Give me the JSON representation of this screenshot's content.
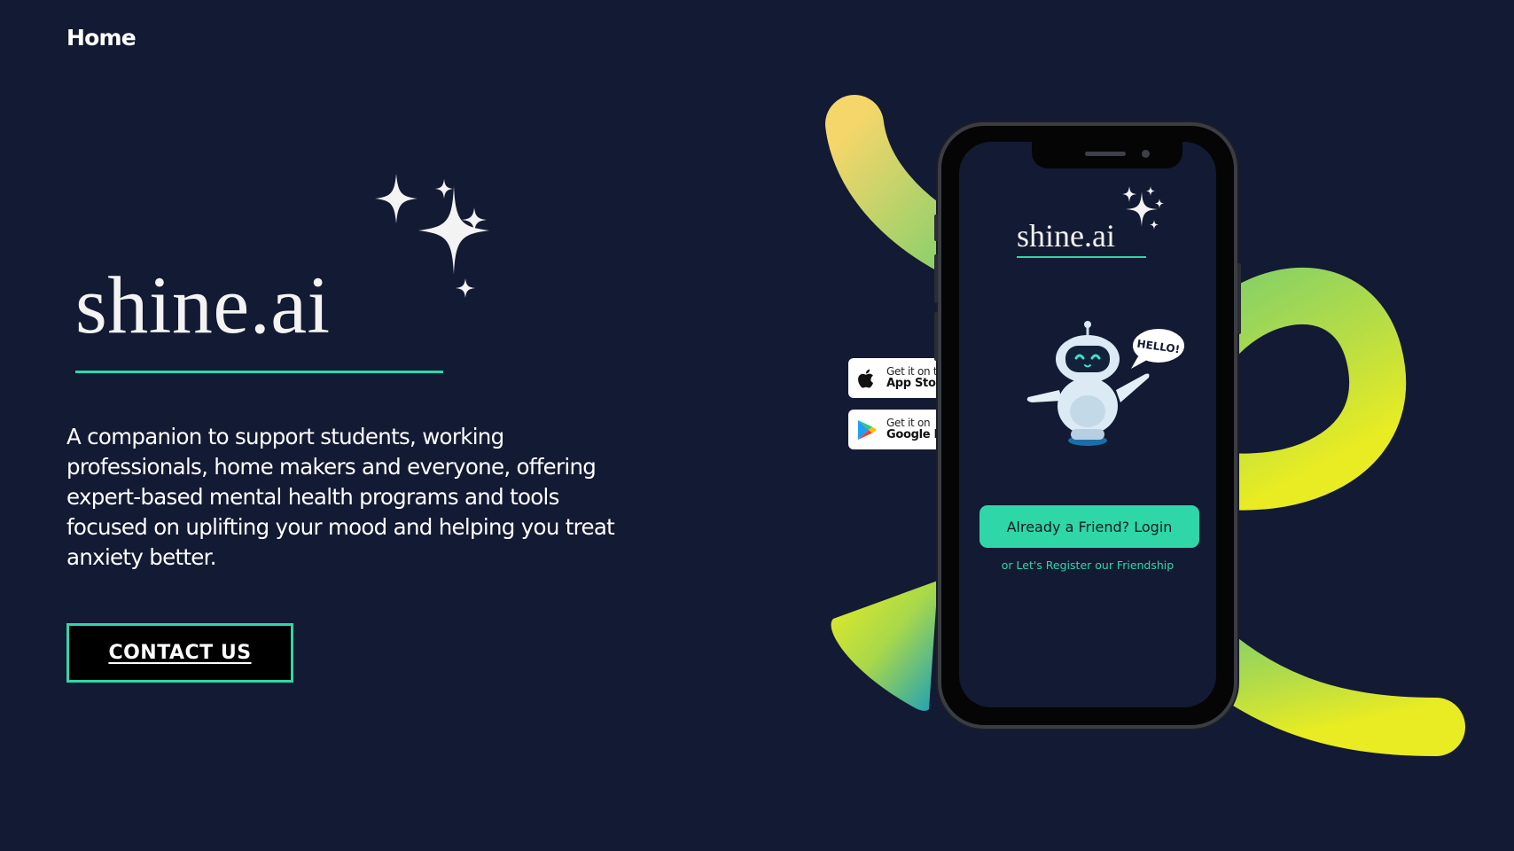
{
  "nav": {
    "home_label": "Home"
  },
  "hero": {
    "brand_name": "shine.ai",
    "tagline": "A companion to support students, working professionals, home makers and everyone, offering expert-based mental health programs and tools focused on uplifting your mood and helping you treat anxiety better.",
    "contact_label": "CONTACT US"
  },
  "badges": {
    "app_store": {
      "small": "Get it on the",
      "big": "App Store",
      "icon": "apple-icon"
    },
    "google_play": {
      "small": "Get it on",
      "big": "Google Play",
      "icon": "google-play-icon"
    }
  },
  "phone": {
    "brand_name": "shine.ai",
    "speech_bubble": "HELLO!",
    "login_label": "Already a Friend? Login",
    "register_prefix": "or ",
    "register_link": "Let's Register our Friendship"
  },
  "colors": {
    "background": "#131a33",
    "accent": "#2fd7a8",
    "swirl_start": "#f4d66a",
    "swirl_mid": "#7fcf6b",
    "swirl_end": "#e9ec22"
  }
}
